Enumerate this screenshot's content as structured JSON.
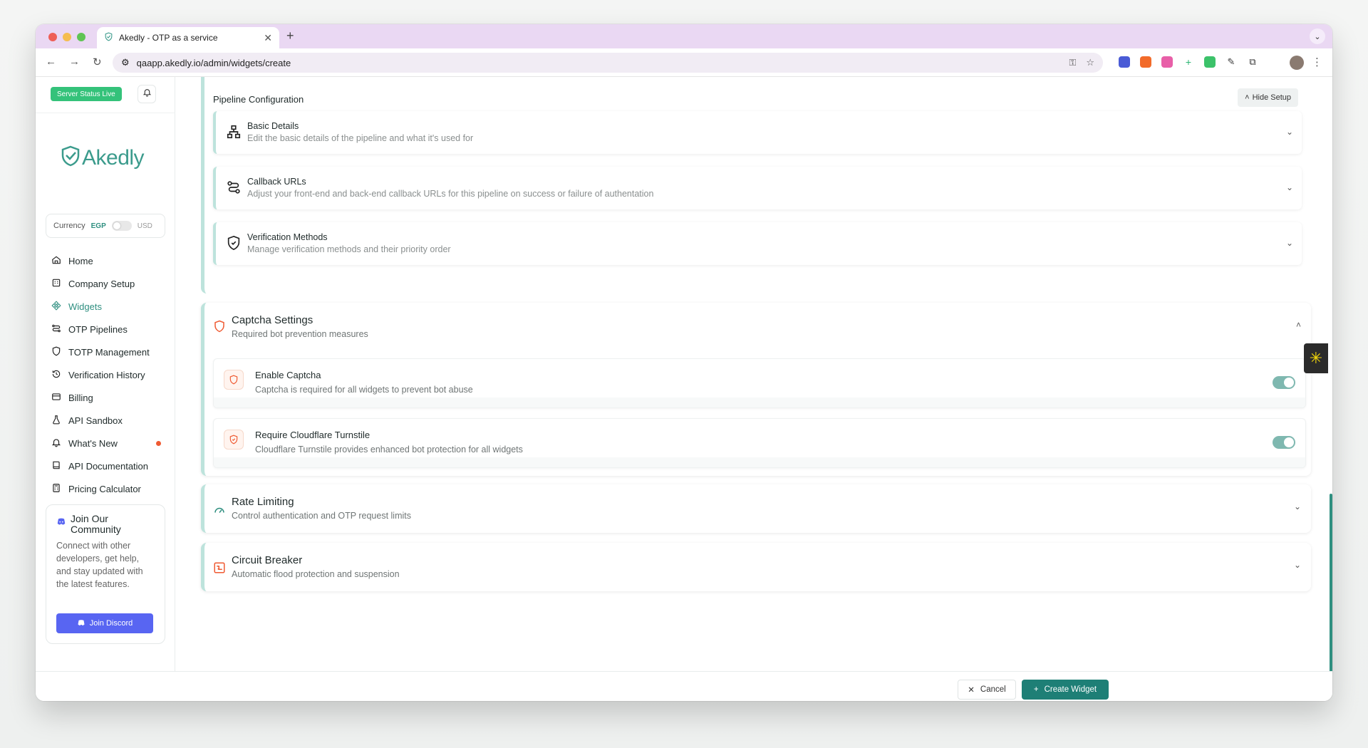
{
  "browser": {
    "tab_title": "Akedly - OTP as a service",
    "url": "qaapp.akedly.io/admin/widgets/create"
  },
  "sidebar": {
    "status_badge": "Server Status Live",
    "logo_text": "Akedly",
    "currency": {
      "label": "Currency",
      "left": "EGP",
      "right": "USD"
    },
    "items": [
      {
        "label": "Home",
        "icon": "home-icon"
      },
      {
        "label": "Company Setup",
        "icon": "building-icon"
      },
      {
        "label": "Widgets",
        "icon": "widgets-icon"
      },
      {
        "label": "OTP Pipelines",
        "icon": "pipeline-icon"
      },
      {
        "label": "TOTP Management",
        "icon": "shield-icon"
      },
      {
        "label": "Verification History",
        "icon": "history-icon"
      },
      {
        "label": "Billing",
        "icon": "card-icon"
      },
      {
        "label": "API Sandbox",
        "icon": "flask-icon"
      },
      {
        "label": "What's New",
        "icon": "bell-icon"
      },
      {
        "label": "API Documentation",
        "icon": "book-icon"
      },
      {
        "label": "Pricing Calculator",
        "icon": "calculator-icon"
      }
    ],
    "community": {
      "title": "Join Our Community",
      "text": "Connect with other developers, get help, and stay updated with the latest features.",
      "button": "Join Discord"
    }
  },
  "pipeline": {
    "title": "Pipeline Configuration",
    "hide_button": "Hide Setup",
    "cards": [
      {
        "title": "Basic Details",
        "desc": "Edit the basic details of the pipeline and what it's used for"
      },
      {
        "title": "Callback URLs",
        "desc": "Adjust your front-end and back-end callback URLs for this pipeline on success or failure of authentation"
      },
      {
        "title": "Verification Methods",
        "desc": "Manage verification methods and their priority order"
      }
    ]
  },
  "captcha": {
    "title": "Captcha Settings",
    "desc": "Required bot prevention measures",
    "options": [
      {
        "title": "Enable Captcha",
        "desc": "Captcha is required for all widgets to prevent bot abuse",
        "enabled": true
      },
      {
        "title": "Require Cloudflare Turnstile",
        "desc": "Cloudflare Turnstile provides enhanced bot protection for all widgets",
        "enabled": true
      }
    ]
  },
  "rate_limiting": {
    "title": "Rate Limiting",
    "desc": "Control authentication and OTP request limits"
  },
  "circuit_breaker": {
    "title": "Circuit Breaker",
    "desc": "Automatic flood protection and suspension"
  },
  "footer": {
    "cancel": "Cancel",
    "create": "Create Widget"
  },
  "colors": {
    "accent": "#2f8f80",
    "accent_light": "#bde3dc",
    "warning": "#ef5a32",
    "discord": "#5865f2"
  }
}
